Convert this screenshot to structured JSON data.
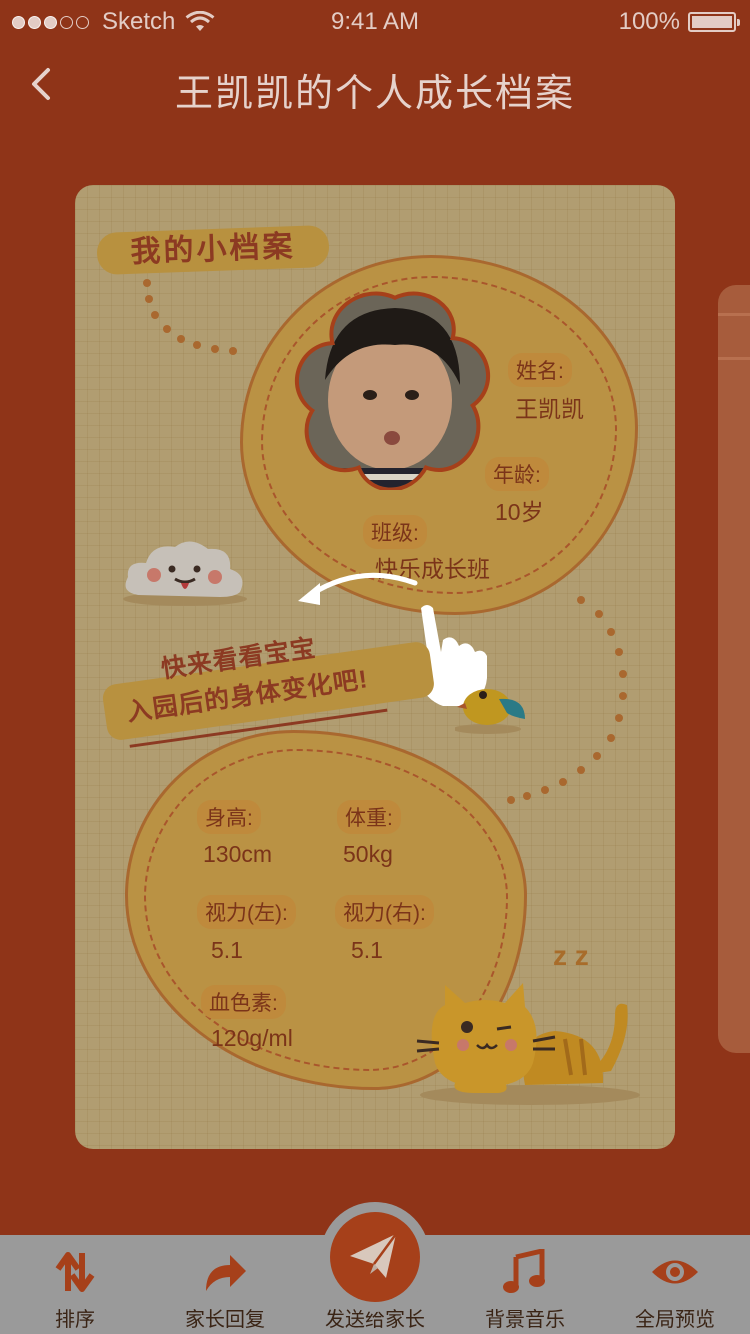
{
  "status_bar": {
    "carrier": "Sketch",
    "time": "9:41 AM",
    "battery": "100%"
  },
  "nav": {
    "title": "王凯凯的个人成长档案"
  },
  "card": {
    "banner_title": "我的小档案",
    "profile": {
      "name_label": "姓名:",
      "name_value": "王凯凯",
      "age_label": "年龄:",
      "age_value": "10岁",
      "class_label": "班级:",
      "class_value": "快乐成长班"
    },
    "slogan": {
      "line1": "快来看看宝宝",
      "line2": "入园后的身体变化吧!"
    },
    "stats": {
      "height_label": "身高:",
      "height_value": "130cm",
      "weight_label": "体重:",
      "weight_value": "50kg",
      "vision_left_label": "视力(左):",
      "vision_left_value": "5.1",
      "vision_right_label": "视力(右):",
      "vision_right_value": "5.1",
      "hemoglobin_label": "血色素:",
      "hemoglobin_value": "120g/ml"
    },
    "decor_text": "z z"
  },
  "tab_bar": {
    "sort": "排序",
    "parent_reply": "家长回复",
    "send_to_parent": "发送给家长",
    "bg_music": "背景音乐",
    "preview": "全局预览"
  },
  "colors": {
    "background": "#8f3418",
    "accent": "#a6401a",
    "tab_bar": "#9a9a9a"
  }
}
